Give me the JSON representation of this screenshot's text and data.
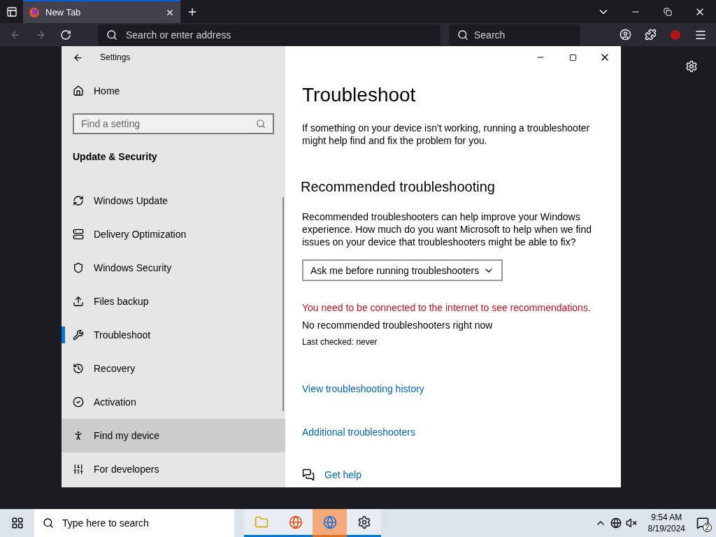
{
  "browser": {
    "tabs": [
      {
        "label": "New Tab",
        "selected": true
      }
    ],
    "address_placeholder": "Search or enter address",
    "search_placeholder": "Search"
  },
  "settings": {
    "title": "Settings",
    "home": "Home",
    "search_placeholder": "Find a setting",
    "section": "Update & Security",
    "items": [
      {
        "label": "Windows Update",
        "selected": false,
        "hovered": false
      },
      {
        "label": "Delivery Optimization",
        "selected": false,
        "hovered": false
      },
      {
        "label": "Windows Security",
        "selected": false,
        "hovered": false
      },
      {
        "label": "Files backup",
        "selected": false,
        "hovered": false
      },
      {
        "label": "Troubleshoot",
        "selected": true,
        "hovered": false
      },
      {
        "label": "Recovery",
        "selected": false,
        "hovered": false
      },
      {
        "label": "Activation",
        "selected": false,
        "hovered": false
      },
      {
        "label": "Find my device",
        "selected": false,
        "hovered": true
      },
      {
        "label": "For developers",
        "selected": false,
        "hovered": false
      }
    ]
  },
  "page": {
    "title": "Troubleshoot",
    "intro": "If something on your device isn't working, running a troubleshooter might help find and fix the problem for you.",
    "heading": "Recommended troubleshooting",
    "description": "Recommended troubleshooters can help improve your Windows experience. How much do you want Microsoft to help when we find issues on your device that troubleshooters might be able to fix?",
    "dropdown": "Ask me before running troubleshooters",
    "warning": "You need to be connected to the internet to see recommendations.",
    "status": "No recommended troubleshooters right now",
    "last_checked": "Last checked: never",
    "links": [
      "View troubleshooting history",
      "Additional troubleshooters"
    ],
    "help_link": "Get help"
  },
  "taskbar": {
    "search_placeholder": "Type here to search",
    "apps": [
      {
        "active": false,
        "running": true
      },
      {
        "active": false,
        "running": true
      },
      {
        "active": true,
        "running": true
      },
      {
        "active": false,
        "running": true
      }
    ],
    "time": "9:54 AM",
    "date": "8/19/2024",
    "notifications": "2"
  }
}
